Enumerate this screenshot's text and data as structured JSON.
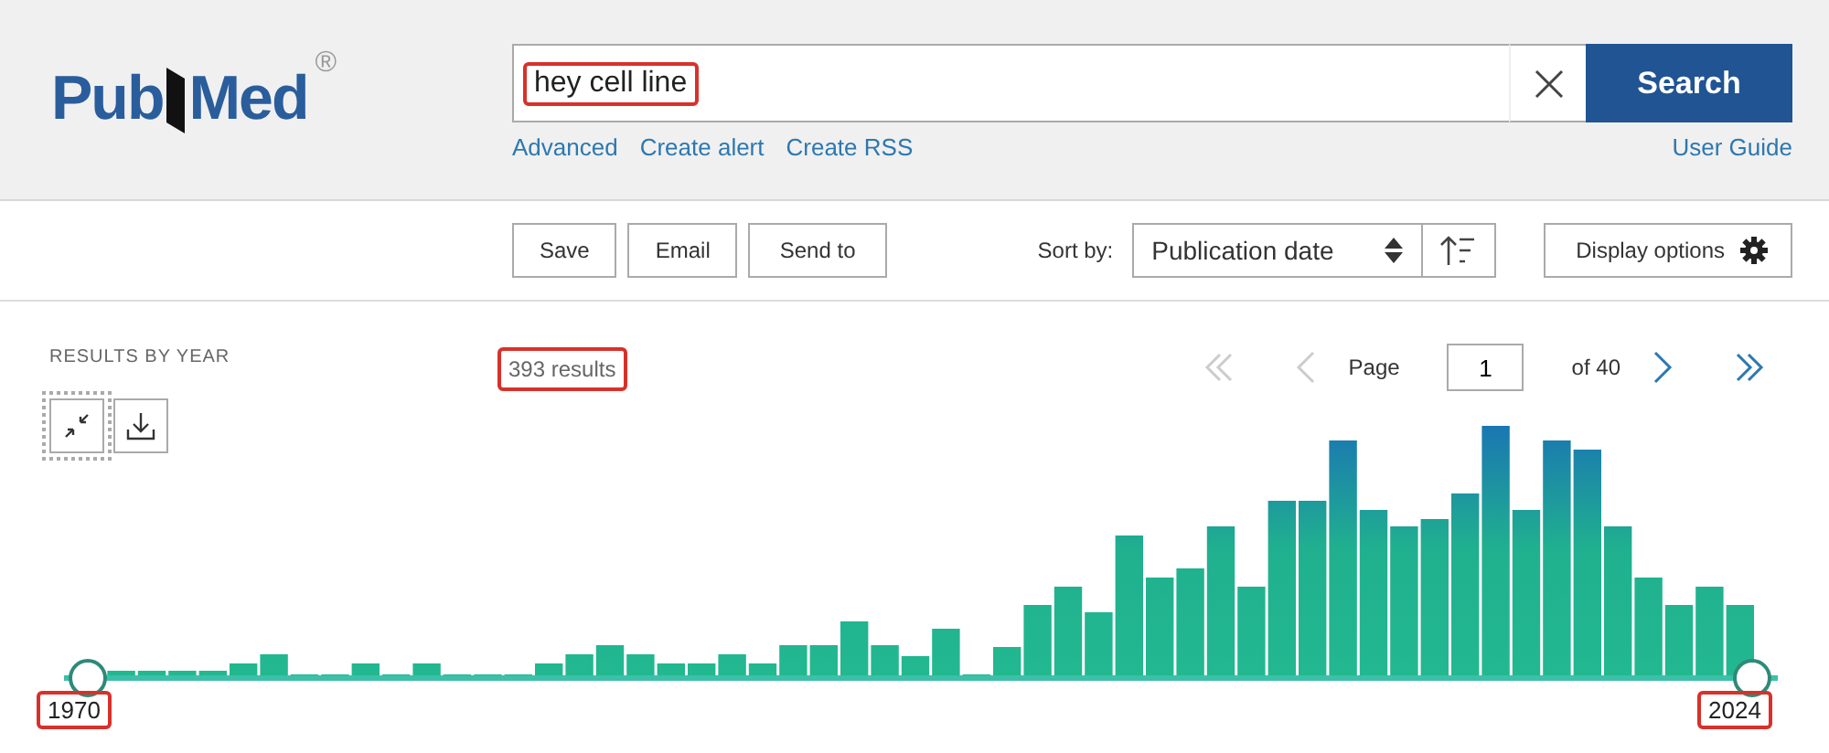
{
  "logo": {
    "parts": [
      "Pub",
      "Med"
    ],
    "mark": "®"
  },
  "search": {
    "value": "hey cell line",
    "highlighted": true,
    "button": "Search"
  },
  "search_links": [
    "Advanced",
    "Create alert",
    "Create RSS"
  ],
  "user_guide": "User Guide",
  "actions": [
    "Save",
    "Email",
    "Send to"
  ],
  "sort": {
    "label": "Sort by:",
    "value": "Publication date"
  },
  "display_options": "Display options",
  "results_by_year": {
    "title": "RESULTS BY YEAR"
  },
  "results_count": {
    "text": "393 results",
    "highlighted": true
  },
  "pagination": {
    "label": "Page",
    "value": "1",
    "total": "of 40",
    "first_disabled": true,
    "prev_disabled": true,
    "next_disabled": false,
    "last_disabled": false
  },
  "year_range": {
    "start": {
      "label": "1970",
      "highlighted": true
    },
    "end": {
      "label": "2024",
      "highlighted": true
    }
  }
}
